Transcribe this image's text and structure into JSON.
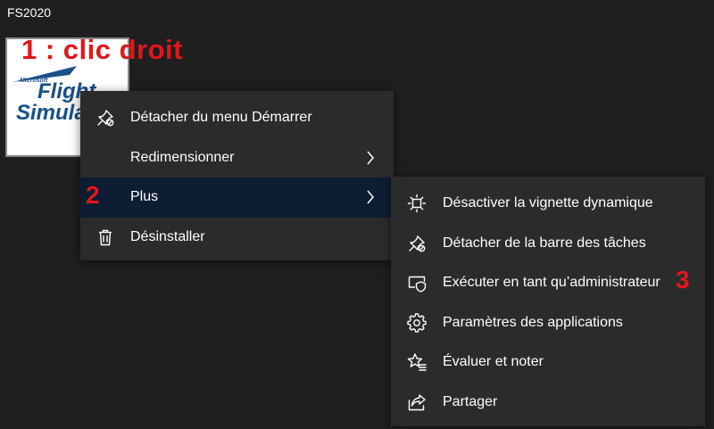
{
  "group": {
    "title": "FS2020"
  },
  "tile": {
    "logo_top": "Microsoft",
    "logo_line1": "Flight",
    "logo_line2": "Simula"
  },
  "annotations": {
    "step1": "1 : clic droit",
    "step2": "2",
    "step3": "3"
  },
  "context_menu": {
    "items": [
      {
        "label": "Détacher du menu Démarrer",
        "icon": "unpin-icon"
      },
      {
        "label": "Redimensionner",
        "icon": "",
        "submenu": true
      },
      {
        "label": "Plus",
        "icon": "",
        "submenu": true,
        "active": true
      },
      {
        "label": "Désinstaller",
        "icon": "trash-icon"
      }
    ]
  },
  "submenu": {
    "items": [
      {
        "label": "Désactiver la vignette dynamique",
        "icon": "live-tile-icon"
      },
      {
        "label": "Détacher de la barre des tâches",
        "icon": "unpin-icon"
      },
      {
        "label": "Exécuter en tant qu’administrateur",
        "icon": "admin-shield-icon"
      },
      {
        "label": "Paramètres des applications",
        "icon": "gear-icon"
      },
      {
        "label": "Évaluer et noter",
        "icon": "star-rating-icon"
      },
      {
        "label": "Partager",
        "icon": "share-icon"
      }
    ]
  },
  "colors": {
    "background": "#1f1f1f",
    "menu_background": "#2b2b2b",
    "menu_active": "#0d1d33",
    "annotation": "#e3161b",
    "text": "#ffffff"
  }
}
